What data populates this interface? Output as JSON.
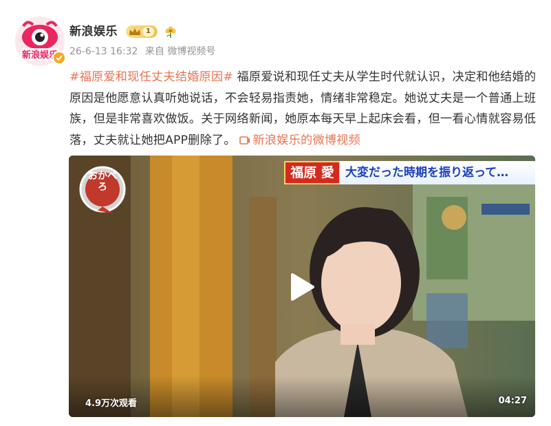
{
  "post": {
    "author": "新浪娱乐",
    "vip_level": "1",
    "timestamp": "26-6-13 16:32",
    "source": "来自 微博视频号",
    "avatar_text": "新浪娱乐",
    "hashtag": "#福原爱和现任丈夫结婚原因#",
    "body": " 福原爱说和现任丈夫从学生时代就认识，决定和他结婚的原因是他愿意认真听她说话，不会轻易指责她，情绪非常稳定。她说丈夫是一个普通上班族，但是非常喜欢做饭。关于网络新闻，她原本每天早上起床会看，但一看心情就容易低落，丈夫就让她把APP删除了。",
    "video_link": "新浪娱乐的微博视频"
  },
  "video": {
    "name_caption": "福原 愛",
    "sub_caption": "大変だった時期を振り返って…",
    "show_logo_text": "おかべろ",
    "views": "4.9万次观看",
    "duration": "04:27"
  },
  "colors": {
    "accent": "#eb7350",
    "text": "#333333",
    "meta": "#939393",
    "verified": "#f5a623"
  }
}
